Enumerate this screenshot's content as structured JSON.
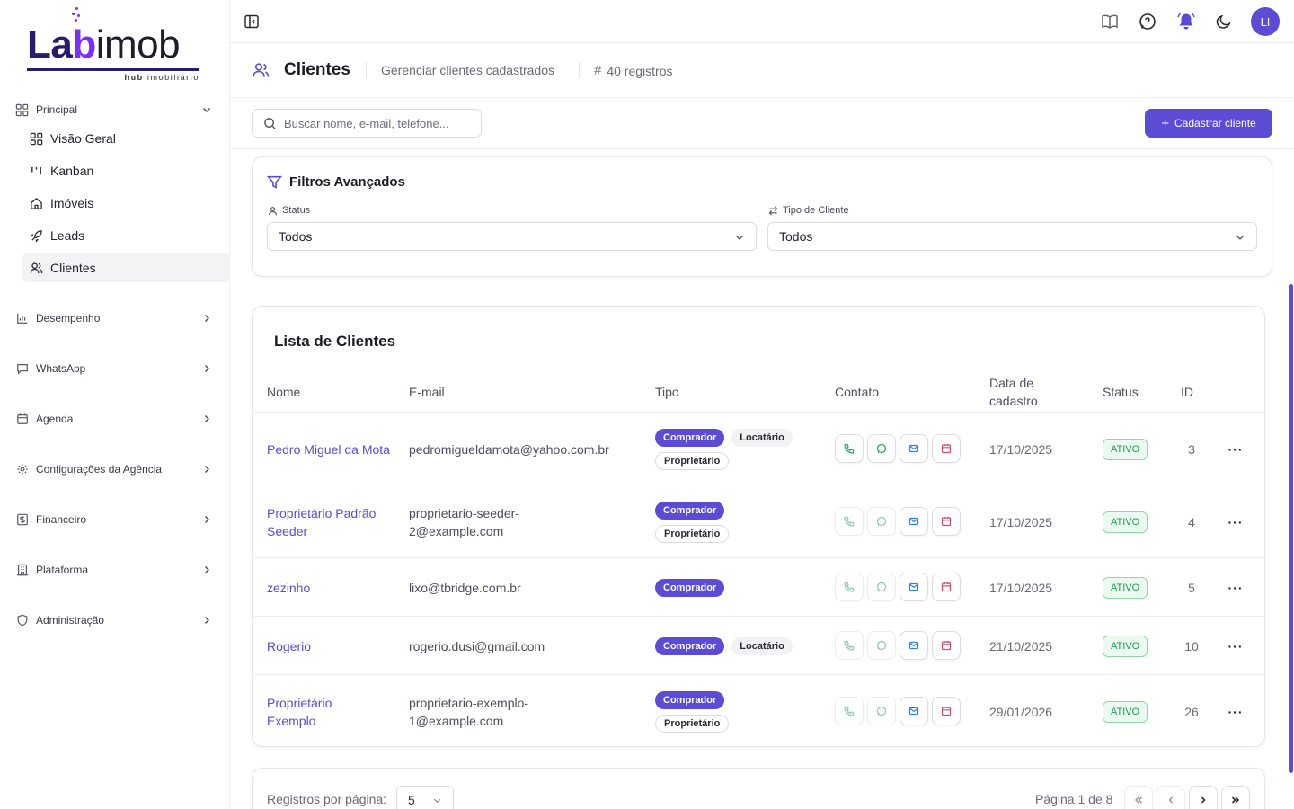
{
  "brand": {
    "logo_text_1": "La",
    "logo_text_b": "b",
    "logo_text_2": "imob",
    "subtitle_bold": "hub",
    "subtitle_rest": "imobiliário"
  },
  "sidebar": {
    "principal_label": "Principal",
    "items": [
      {
        "label": "Visão Geral",
        "icon": "grid-icon"
      },
      {
        "label": "Kanban",
        "icon": "kanban-icon"
      },
      {
        "label": "Imóveis",
        "icon": "home-icon"
      },
      {
        "label": "Leads",
        "icon": "rocket-icon"
      },
      {
        "label": "Clientes",
        "icon": "users-icon",
        "active": true
      }
    ],
    "groups": [
      {
        "label": "Desempenho",
        "icon": "chart-icon"
      },
      {
        "label": "WhatsApp",
        "icon": "message-icon"
      },
      {
        "label": "Agenda",
        "icon": "calendar-icon"
      },
      {
        "label": "Configurações da Agência",
        "icon": "gear-icon"
      },
      {
        "label": "Financeiro",
        "icon": "dollar-icon"
      },
      {
        "label": "Plataforma",
        "icon": "building-icon"
      },
      {
        "label": "Administração",
        "icon": "shield-icon"
      }
    ]
  },
  "topbar": {
    "avatar_initials": "LI"
  },
  "header": {
    "title": "Clientes",
    "subtitle": "Gerenciar clientes cadastrados",
    "count": "40 registros"
  },
  "toolbar": {
    "search_placeholder": "Buscar nome, e-mail, telefone...",
    "add_label": "Cadastrar cliente"
  },
  "filters": {
    "title": "Filtros Avançados",
    "status_label": "Status",
    "status_value": "Todos",
    "tipo_label": "Tipo de Cliente",
    "tipo_value": "Todos"
  },
  "list": {
    "title": "Lista de Clientes",
    "columns": [
      "Nome",
      "E-mail",
      "Tipo",
      "Contato",
      "Data de cadastro",
      "Status",
      "ID"
    ],
    "rows": [
      {
        "name": "Pedro Miguel da Mota",
        "email": "pedromigueldamota@yahoo.com.br",
        "types": [
          "Comprador",
          "Locatário",
          "Proprietário"
        ],
        "date": "17/10/2025",
        "status": "ATIVO",
        "id": "3"
      },
      {
        "name": "Proprietário Padrão Seeder",
        "email": "proprietario-seeder-2@example.com",
        "types": [
          "Comprador",
          "Proprietário"
        ],
        "date": "17/10/2025",
        "status": "ATIVO",
        "id": "4"
      },
      {
        "name": "zezinho",
        "email": "lixo@tbridge.com.br",
        "types": [
          "Comprador"
        ],
        "date": "17/10/2025",
        "status": "ATIVO",
        "id": "5"
      },
      {
        "name": "Rogerio",
        "email": "rogerio.dusi@gmail.com",
        "types": [
          "Comprador",
          "Locatário"
        ],
        "date": "21/10/2025",
        "status": "ATIVO",
        "id": "10"
      },
      {
        "name": "Proprietário Exemplo",
        "email": "proprietario-exemplo-1@example.com",
        "types": [
          "Comprador",
          "Proprietário"
        ],
        "date": "29/01/2026",
        "status": "ATIVO",
        "id": "26"
      }
    ]
  },
  "pagination": {
    "per_page_label": "Registros por página:",
    "per_page_value": "5",
    "page_info": "Página 1 de 8"
  },
  "colors": {
    "accent": "#5b4bd5",
    "status_active": "#1f9a4e"
  }
}
